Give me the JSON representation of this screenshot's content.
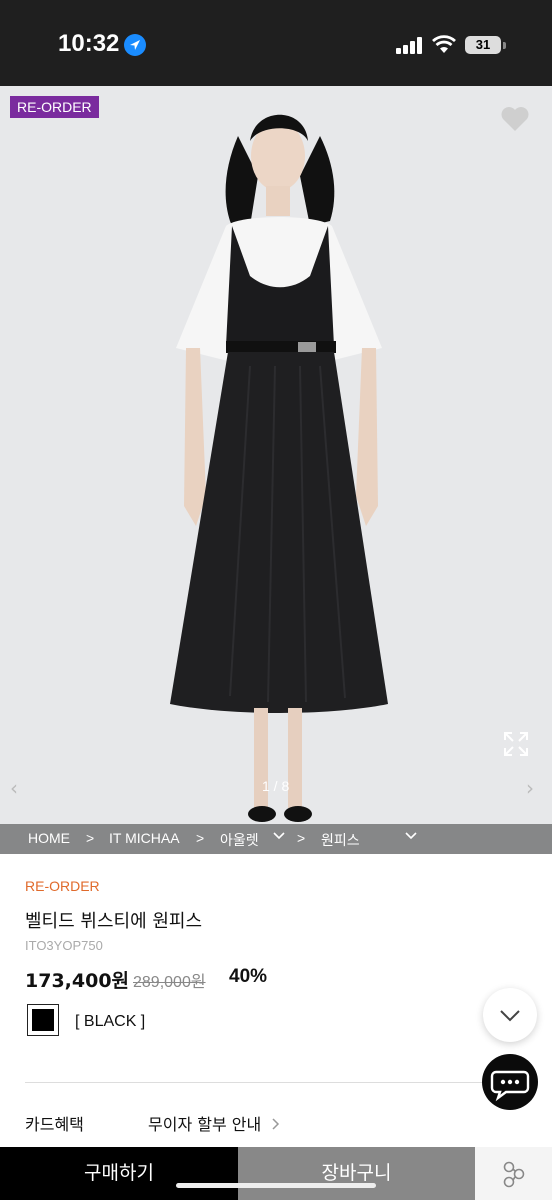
{
  "status": {
    "time": "10:32",
    "battery": "31"
  },
  "hero": {
    "badge": "RE-ORDER",
    "counter": "1 / 8"
  },
  "breadcrumb": {
    "home": "HOME",
    "sep": ">",
    "brand": "IT MICHAA",
    "cat1": "아울렛",
    "cat2": "원피스"
  },
  "product": {
    "brand": "RE-ORDER",
    "name": "벨티드 뷔스티에 원피스",
    "code": "ITO3YOP750",
    "price": "173,400원",
    "original_price": "289,000원",
    "discount": "40%",
    "color": "[ BLACK ]"
  },
  "benefit": {
    "label": "카드혜택",
    "link": "무이자 할부 안내"
  },
  "actions": {
    "buy": "구매하기",
    "cart": "장바구니"
  },
  "colors": {
    "brand_orange": "#e06a2b",
    "badge_purple": "#7a2b9e"
  }
}
